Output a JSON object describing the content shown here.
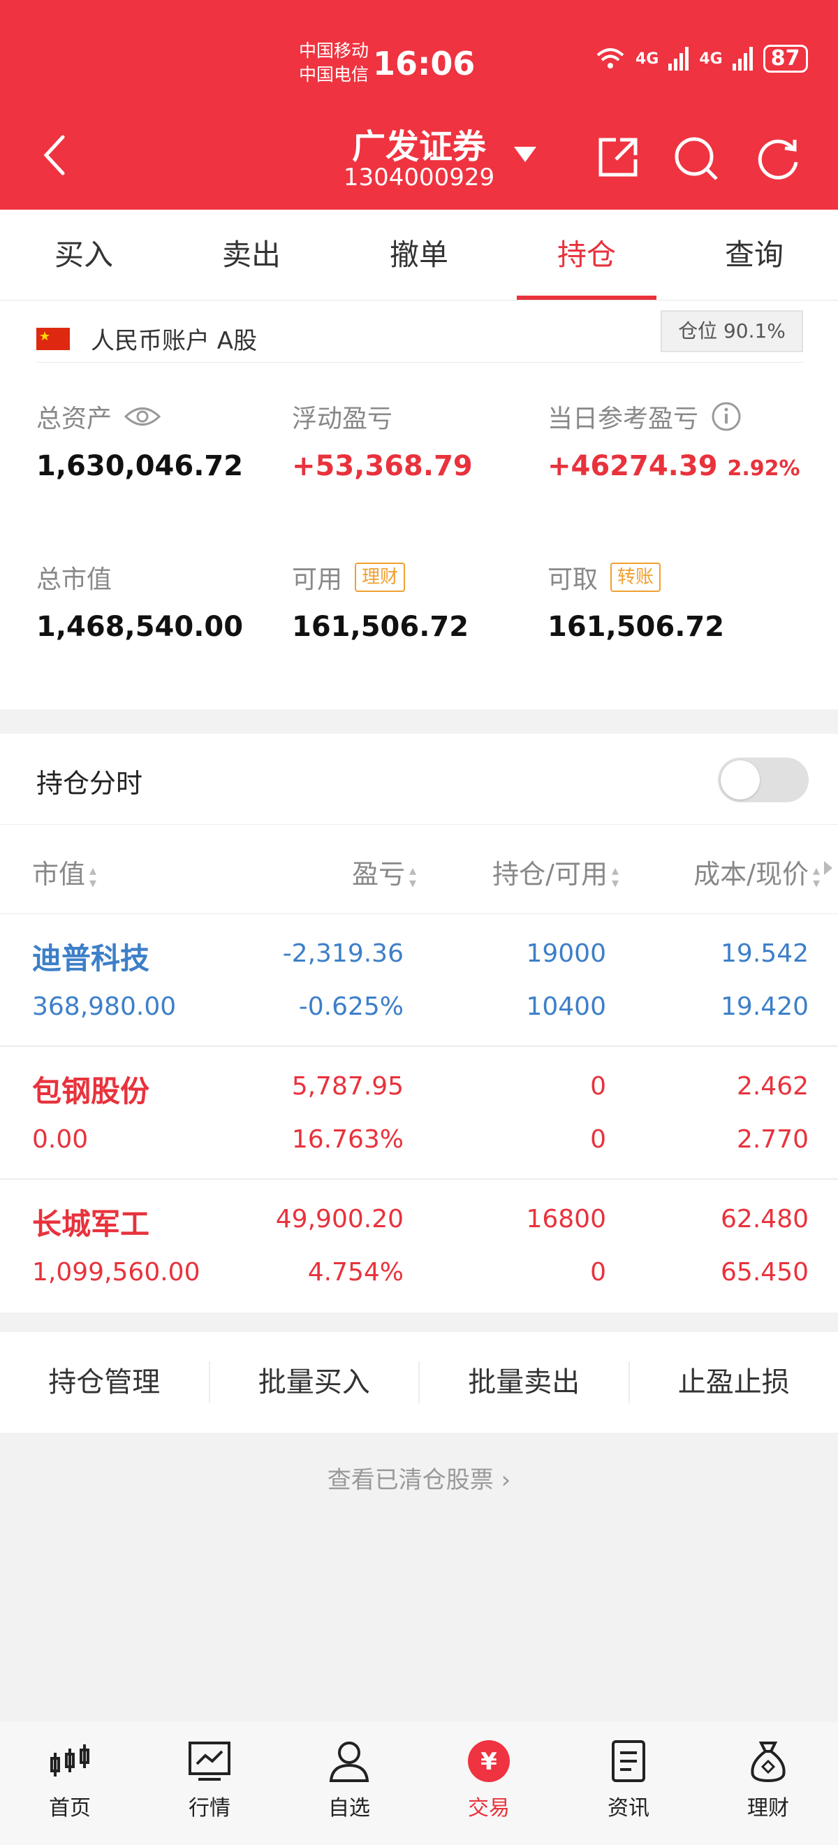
{
  "status": {
    "carrier1": "中国移动",
    "carrier2": "中国电信",
    "time": "16:06",
    "net1": "4G",
    "net2": "4G",
    "battery": "87"
  },
  "header": {
    "title": "广发证券",
    "account": "1304000929"
  },
  "tabs": [
    {
      "label": "买入"
    },
    {
      "label": "卖出"
    },
    {
      "label": "撤单"
    },
    {
      "label": "持仓"
    },
    {
      "label": "查询"
    }
  ],
  "account": {
    "label": "人民币账户 A股",
    "position_ratio": "仓位 90.1%"
  },
  "metrics": {
    "total_assets_label": "总资产",
    "total_assets": "1,630,046.72",
    "float_pl_label": "浮动盈亏",
    "float_pl": "+53,368.79",
    "today_pl_label": "当日参考盈亏",
    "today_pl": "+46274.39",
    "today_pct": "2.92%",
    "market_value_label": "总市值",
    "market_value": "1,468,540.00",
    "available_label": "可用",
    "available_tag": "理财",
    "available": "161,506.72",
    "withdrawable_label": "可取",
    "withdrawable_tag": "转账",
    "withdrawable": "161,506.72"
  },
  "timeshare": {
    "label": "持仓分时"
  },
  "table": {
    "headers": [
      "市值",
      "盈亏",
      "持仓/可用",
      "成本/现价"
    ],
    "rows": [
      {
        "name": "迪普科技",
        "market_value": "368,980.00",
        "pl": "-2,319.36",
        "pl_pct": "-0.625%",
        "position": "19000",
        "available": "10400",
        "cost": "19.542",
        "price": "19.420",
        "color": "#3d7fc8"
      },
      {
        "name": "包钢股份",
        "market_value": "0.00",
        "pl": "5,787.95",
        "pl_pct": "16.763%",
        "position": "0",
        "available": "0",
        "cost": "2.462",
        "price": "2.770",
        "color": "#e8323c"
      },
      {
        "name": "长城军工",
        "market_value": "1,099,560.00",
        "pl": "49,900.20",
        "pl_pct": "4.754%",
        "position": "16800",
        "available": "0",
        "cost": "62.480",
        "price": "65.450",
        "color": "#e8323c"
      }
    ]
  },
  "actions": [
    "持仓管理",
    "批量买入",
    "批量卖出",
    "止盈止损"
  ],
  "cleared_link": "查看已清仓股票",
  "nav": [
    {
      "label": "首页",
      "icon": "home-candles-icon"
    },
    {
      "label": "行情",
      "icon": "chart-icon"
    },
    {
      "label": "自选",
      "icon": "user-icon"
    },
    {
      "label": "交易",
      "icon": "yuan-icon"
    },
    {
      "label": "资讯",
      "icon": "document-icon"
    },
    {
      "label": "理财",
      "icon": "money-bag-icon"
    }
  ],
  "colors": {
    "brand": "#ef3340",
    "up": "#e8323c",
    "down": "#3d7fc8"
  }
}
